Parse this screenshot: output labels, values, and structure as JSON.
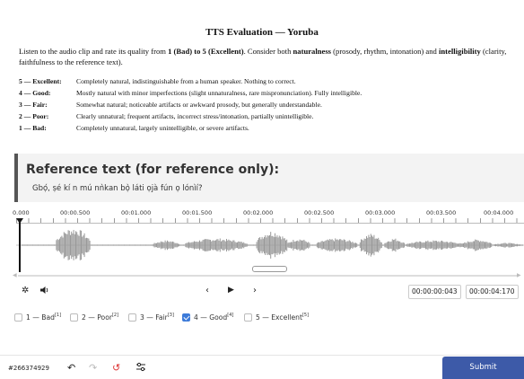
{
  "header": {
    "title": "TTS Evaluation — Yoruba"
  },
  "instructions": {
    "p1": "Listen to the audio clip and rate its quality from ",
    "scale": "1 (Bad) to 5 (Excellent)",
    "p2": ". Consider both ",
    "naturalness": "naturalness",
    "p3": " (prosody, rhythm, intonation) and ",
    "intelligibility": "intelligibility",
    "p4": " (clarity, faithfulness to the reference text)."
  },
  "rubric": [
    {
      "level": "5 — Excellent:",
      "desc": "Completely natural, indistinguishable from a human speaker. Nothing to correct."
    },
    {
      "level": "4 — Good:",
      "desc": "Mostly natural with minor imperfections (slight unnaturalness, rare mispronunciation). Fully intelligible."
    },
    {
      "level": "3 — Fair:",
      "desc": "Somewhat natural; noticeable artifacts or awkward prosody, but generally understandable."
    },
    {
      "level": "2 — Poor:",
      "desc": "Clearly unnatural; frequent artifacts, incorrect stress/intonation, partially unintelligible."
    },
    {
      "level": "1 — Bad:",
      "desc": "Completely unnatural, largely unintelligible, or severe artifacts."
    }
  ],
  "reference": {
    "title": "Reference text (for reference only):",
    "text": "Gbọ́, ṣé kí n mú nǹkan bọ̀ láti ọjà fún ọ lónìí?"
  },
  "player": {
    "ticks": [
      "0.000",
      "00:00.500",
      "00:01.000",
      "00:01.500",
      "00:02.000",
      "00:02.500",
      "00:03.000",
      "00:03.500",
      "00:04.000"
    ],
    "current_time": "00:00:00:043",
    "duration": "00:00:04:170",
    "progress": 0.01,
    "icons": {
      "settings": "gear-icon",
      "volume": "volume-icon",
      "prev": "chevron-left-icon",
      "play": "play-icon",
      "next": "chevron-right-icon"
    }
  },
  "choices": [
    {
      "label": "1 — Bad",
      "hotkey": "[1]",
      "checked": false
    },
    {
      "label": "2 — Poor",
      "hotkey": "[2]",
      "checked": false
    },
    {
      "label": "3 — Fair",
      "hotkey": "[3]",
      "checked": false
    },
    {
      "label": "4 — Good",
      "hotkey": "[4]",
      "checked": true
    },
    {
      "label": "5 — Excellent",
      "hotkey": "[5]",
      "checked": false
    }
  ],
  "footer": {
    "task_id": "#266374929",
    "submit_label": "Submit",
    "icons": [
      "undo-icon",
      "redo-icon",
      "reset-icon",
      "settings-sliders-icon"
    ]
  },
  "colors": {
    "accent": "#3d5aa8",
    "checkbox": "#3d7bd9",
    "waveform": "#9a9a9a"
  }
}
